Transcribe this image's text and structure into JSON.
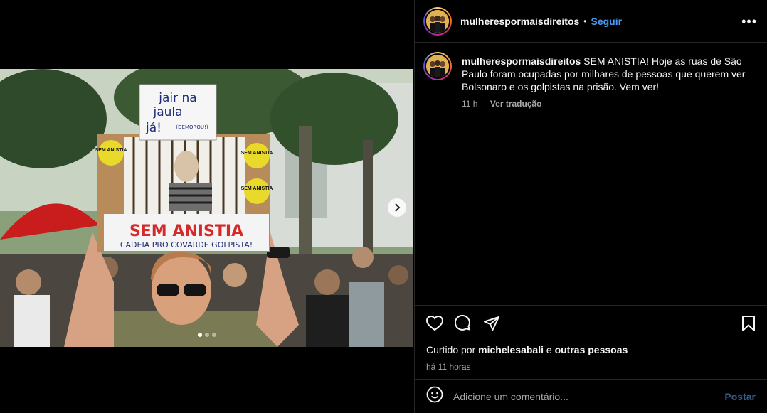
{
  "post": {
    "username": "mulherespormaisdireitos",
    "separator": "•",
    "follow_label": "Seguir",
    "more_label": "•••",
    "caption": "SEM ANISTIA! Hoje as ruas de São Paulo foram ocupadas por milhares de pessoas que querem ver Bolsonaro e os golpistas na prisão. Vem ver!",
    "caption_time": "11 h",
    "translate_label": "Ver tradução",
    "liked_by_prefix": "Curtido por",
    "liked_by_user": "michelesabali",
    "liked_by_conj": "e",
    "liked_by_others": "outras pessoas",
    "posted_ago": "há 11 horas",
    "comment_placeholder": "Adicione um comentário...",
    "post_label": "Postar"
  },
  "photo": {
    "sign_top_lines": [
      "jair na",
      "jaula",
      "já!"
    ],
    "sign_top_note": "(DEMOROU!)",
    "sign_main": "SEM ANISTIA",
    "sign_sub": "CADEIA PRO COVARDE GOLPISTA!",
    "sticker_text": "SEM ANISTIA",
    "carousel": {
      "count": 3,
      "active_index": 0
    }
  },
  "icons": {
    "like": "heart-icon",
    "comment": "comment-icon",
    "share": "send-icon",
    "save": "bookmark-icon",
    "emoji": "emoji-icon",
    "next": "chevron-right-icon"
  },
  "colors": {
    "link": "#4a9cf6",
    "post_disabled": "#385d84",
    "muted": "#a8a8a8",
    "divider": "#262626"
  }
}
